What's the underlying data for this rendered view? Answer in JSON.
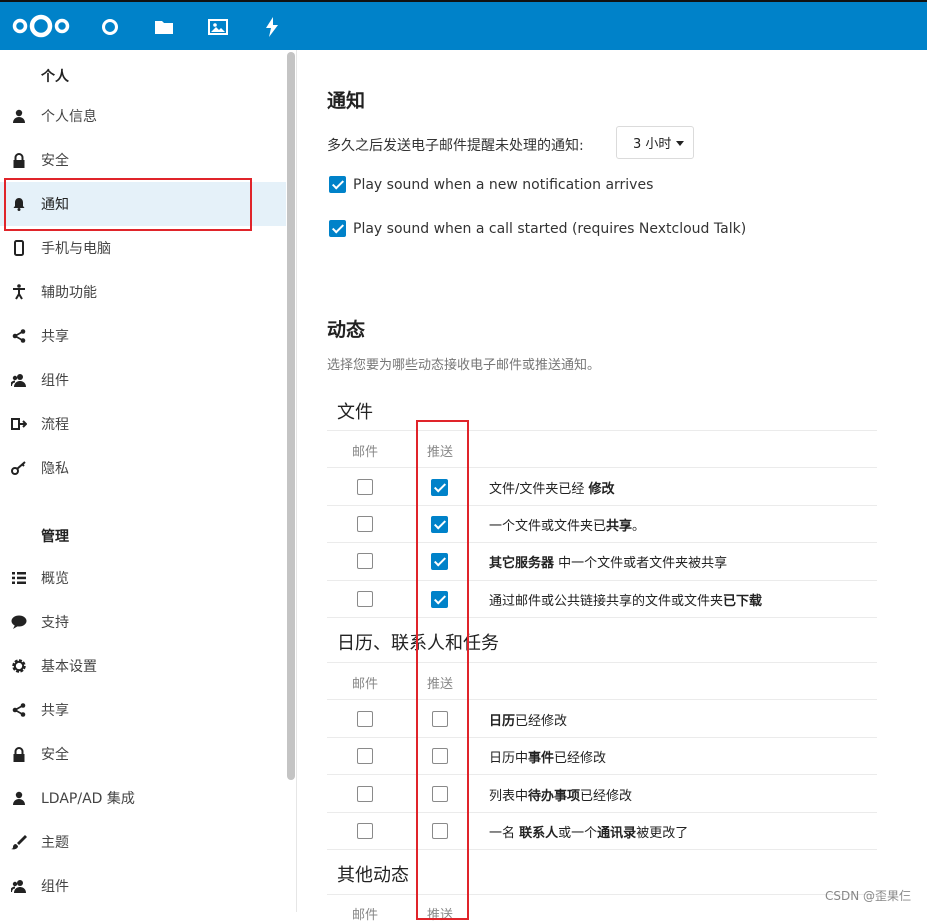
{
  "sidebar": {
    "personal_title": "个人",
    "personal_items": [
      {
        "label": "个人信息",
        "icon": "user-icon"
      },
      {
        "label": "安全",
        "icon": "lock-icon"
      },
      {
        "label": "通知",
        "icon": "bell-icon"
      },
      {
        "label": "手机与电脑",
        "icon": "phone-icon"
      },
      {
        "label": "辅助功能",
        "icon": "accessibility-icon"
      },
      {
        "label": "共享",
        "icon": "share-icon"
      },
      {
        "label": "组件",
        "icon": "group-icon"
      },
      {
        "label": "流程",
        "icon": "flow-icon"
      },
      {
        "label": "隐私",
        "icon": "key-icon"
      }
    ],
    "admin_title": "管理",
    "admin_items": [
      {
        "label": "概览",
        "icon": "list-icon"
      },
      {
        "label": "支持",
        "icon": "chat-icon"
      },
      {
        "label": "基本设置",
        "icon": "gear-icon"
      },
      {
        "label": "共享",
        "icon": "share-icon"
      },
      {
        "label": "安全",
        "icon": "lock-icon"
      },
      {
        "label": "LDAP/AD 集成",
        "icon": "user-icon"
      },
      {
        "label": "主题",
        "icon": "brush-icon"
      },
      {
        "label": "组件",
        "icon": "group-icon"
      }
    ]
  },
  "notifications": {
    "title": "通知",
    "email_delay_label": "多久之后发送电子邮件提醒未处理的通知:",
    "email_delay_value": "3 小时",
    "sound_notification_label": "Play sound when a new notification arrives",
    "sound_notification_checked": true,
    "sound_call_label": "Play sound when a call started (requires Nextcloud Talk)",
    "sound_call_checked": true
  },
  "activity": {
    "title": "动态",
    "hint": "选择您要为哪些动态接收电子邮件或推送通知。",
    "col_mail": "邮件",
    "col_push": "推送",
    "groups": [
      {
        "title": "文件",
        "rows": [
          {
            "pre": "文件/文件夹已经 ",
            "bold": "修改",
            "post": "",
            "mail": false,
            "push": true
          },
          {
            "pre": "一个文件或文件夹已",
            "bold": "共享",
            "post": "。",
            "mail": false,
            "push": true
          },
          {
            "pre": "",
            "bold": "其它服务器",
            "post": " 中一个文件或者文件夹被共享",
            "mail": false,
            "push": true
          },
          {
            "pre": "通过邮件或公共链接共享的文件或文件夹",
            "bold": "已下载",
            "post": "",
            "mail": false,
            "push": true
          }
        ]
      },
      {
        "title": "日历、联系人和任务",
        "rows": [
          {
            "pre": "",
            "bold": "日历",
            "post": "已经修改",
            "mail": false,
            "push": false
          },
          {
            "pre": "日历中",
            "bold": "事件",
            "post": "已经修改",
            "mail": false,
            "push": false
          },
          {
            "pre": "列表中",
            "bold": "待办事项",
            "post": "已经修改",
            "mail": false,
            "push": false
          },
          {
            "pre": "一名 ",
            "bold": "联系人",
            "post": "或一个",
            "bold2": "通讯录",
            "post2": "被更改了",
            "mail": false,
            "push": false
          }
        ]
      },
      {
        "title": "其他动态",
        "rows": []
      }
    ]
  },
  "watermark": "CSDN @歪果仨",
  "colors": {
    "header": "#0082c9",
    "accent": "#0082c9",
    "highlight": "#e0242a",
    "active_bg": "#e5f1f9"
  }
}
